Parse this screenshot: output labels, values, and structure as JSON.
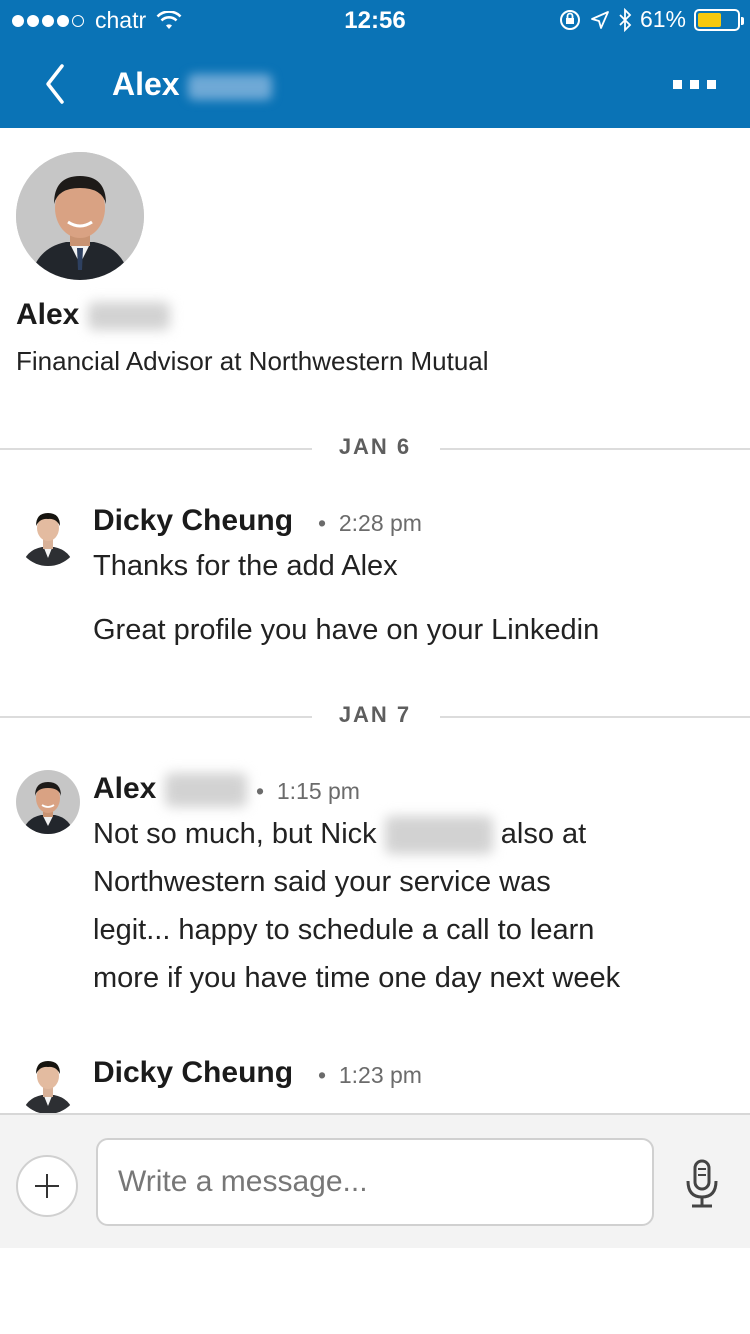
{
  "status_bar": {
    "carrier": "chatr",
    "time": "12:56",
    "battery_percent": "61%",
    "battery_level": 0.61,
    "battery_color": "#f6c90e"
  },
  "nav": {
    "title": "Alex",
    "brand_color": "#0a73b6"
  },
  "profile": {
    "name": "Alex",
    "headline": "Financial Advisor at Northwestern Mutual"
  },
  "conversation": {
    "date_1": "JAN 6",
    "message_1": {
      "sender": "Dicky Cheung",
      "time": "2:28 pm",
      "lines": [
        "Thanks for the add Alex",
        "Great profile you have on your Linkedin"
      ]
    },
    "date_2": "JAN 7",
    "message_2": {
      "sender": "Alex",
      "time": "1:15 pm",
      "line_1_start": "Not so much, but Nick",
      "line_1_end": "also at",
      "line_2": "Northwestern said your service was",
      "line_3": "legit... happy to schedule a call to learn",
      "line_4": "more if you have time one day next week"
    },
    "message_3": {
      "sender": "Dicky Cheung",
      "time": "1:23 pm"
    }
  },
  "composer": {
    "placeholder": "Write a message..."
  },
  "separator": "•"
}
